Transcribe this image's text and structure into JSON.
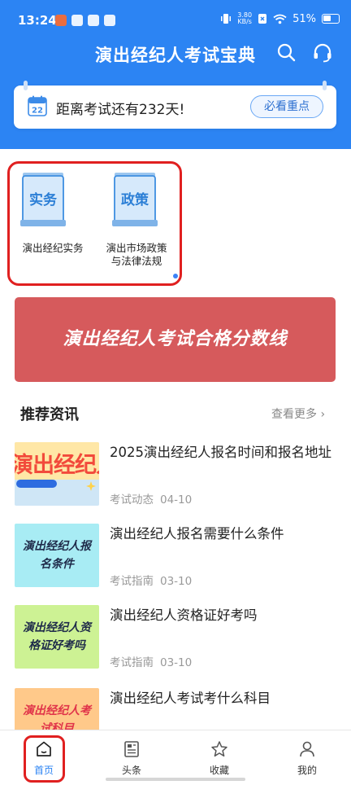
{
  "status_bar": {
    "time": "13:24",
    "net_speed": "3.80",
    "net_unit": "KB/s",
    "battery": "51%"
  },
  "header": {
    "title": "演出经纪人考试宝典"
  },
  "countdown": {
    "calendar_day": "22",
    "text": "距离考试还有232天!",
    "button": "必看重点"
  },
  "categories": [
    {
      "book_label": "实务",
      "label": "演出经纪实务"
    },
    {
      "book_label": "政策",
      "label_line1": "演出市场政策",
      "label_line2": "与法律法规"
    }
  ],
  "banner": {
    "text": "演出经纪人考试合格分数线"
  },
  "news_section": {
    "title": "推荐资讯",
    "more": "查看更多 ›"
  },
  "news": [
    {
      "thumb_text": "演出经纪人",
      "title": "2025演出经纪人报名时间和报名地址",
      "category": "考试动态",
      "date": "04-10"
    },
    {
      "thumb_text": "演出经纪人报名条件",
      "title": "演出经纪人报名需要什么条件",
      "category": "考试指南",
      "date": "03-10"
    },
    {
      "thumb_text": "演出经纪人资格证好考吗",
      "title": "演出经纪人资格证好考吗",
      "category": "考试指南",
      "date": "03-10"
    },
    {
      "thumb_text": "演出经纪人考试科目",
      "title": "演出经纪人考试考什么科目",
      "category": "",
      "date": ""
    }
  ],
  "tabs": [
    {
      "label": "首页",
      "icon": "home-icon"
    },
    {
      "label": "头条",
      "icon": "news-icon"
    },
    {
      "label": "收藏",
      "icon": "star-icon"
    },
    {
      "label": "我的",
      "icon": "user-icon"
    }
  ],
  "colors": {
    "primary": "#2c84f3",
    "banner": "#d65a5c",
    "highlight": "#e02020"
  }
}
